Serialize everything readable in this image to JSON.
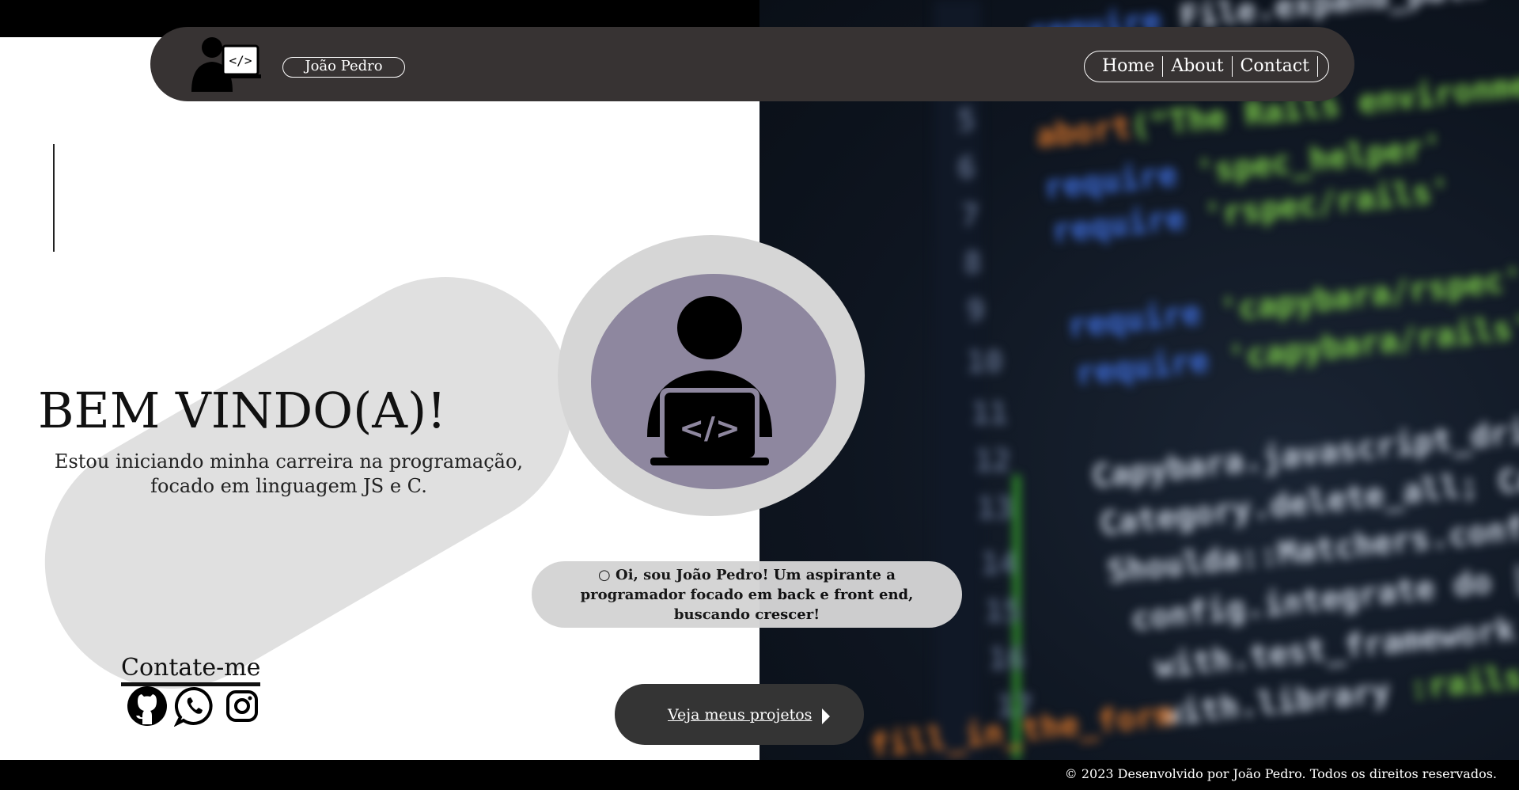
{
  "header": {
    "brand": "João Pedro",
    "nav": [
      "Home",
      "About",
      "Contact"
    ]
  },
  "hero": {
    "title": "BEM VINDO(A)!",
    "subtitle": "Estou iniciando minha carreira na programação, focado em linguagem JS e C."
  },
  "intro": {
    "text": "○ Oi, sou João Pedro! Um aspirante a programador focado em back e front end, buscando crescer!"
  },
  "contact": {
    "title": "Contate-me",
    "icons": [
      "github-icon",
      "whatsapp-icon",
      "instagram-icon"
    ]
  },
  "projects_button": {
    "label": "Veja meus projetos"
  },
  "footer": {
    "text": "© 2023 Desenvolvido por João Pedro. Todos os direitos reservados."
  },
  "colors": {
    "header_bg": "#373333",
    "avatar_outer": "#d6d6d6",
    "avatar_inner": "#8e879f",
    "button_bg": "#343434"
  }
}
